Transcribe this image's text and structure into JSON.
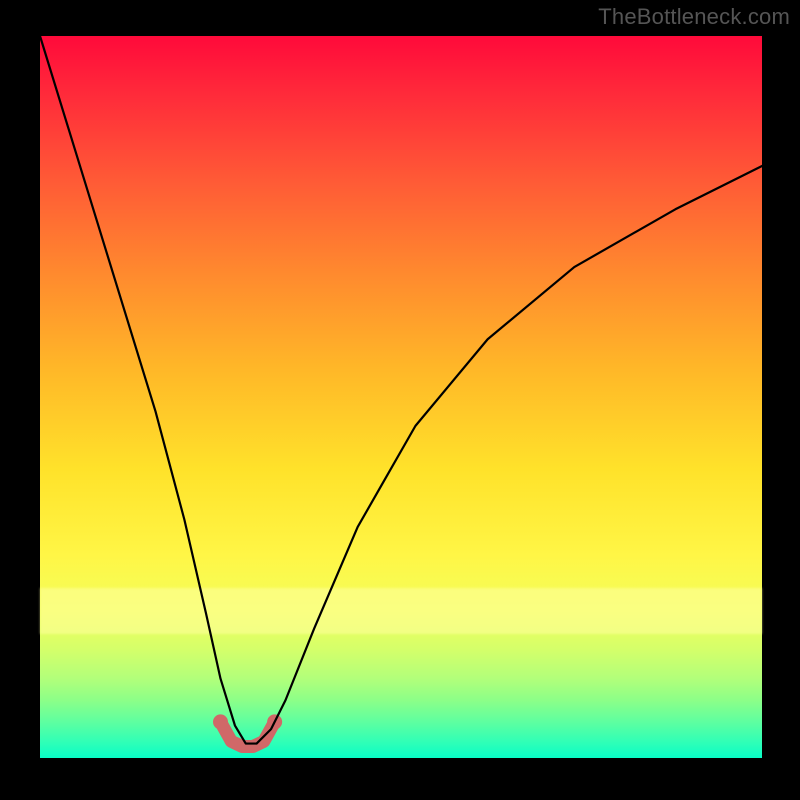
{
  "watermark": "TheBottleneck.com",
  "colors": {
    "frame": "#000000",
    "curve": "#000000",
    "bump": "#d06868"
  },
  "chart_data": {
    "type": "line",
    "title": "",
    "xlabel": "",
    "ylabel": "",
    "xlim": [
      0,
      100
    ],
    "ylim": [
      0,
      100
    ],
    "grid": false,
    "legend": false,
    "series": [
      {
        "name": "bottleneck-curve",
        "x": [
          0,
          4,
          8,
          12,
          16,
          20,
          23,
          25,
          27,
          28.5,
          30,
          32,
          34,
          38,
          44,
          52,
          62,
          74,
          88,
          100
        ],
        "y": [
          100,
          87,
          74,
          61,
          48,
          33,
          20,
          11,
          4.5,
          2,
          2,
          4,
          8,
          18,
          32,
          46,
          58,
          68,
          76,
          82
        ]
      },
      {
        "name": "optimal-zone",
        "x": [
          25,
          26.5,
          28,
          29.5,
          31,
          32.5
        ],
        "y": [
          5,
          2.3,
          1.6,
          1.6,
          2.3,
          5
        ]
      }
    ],
    "annotations": []
  }
}
